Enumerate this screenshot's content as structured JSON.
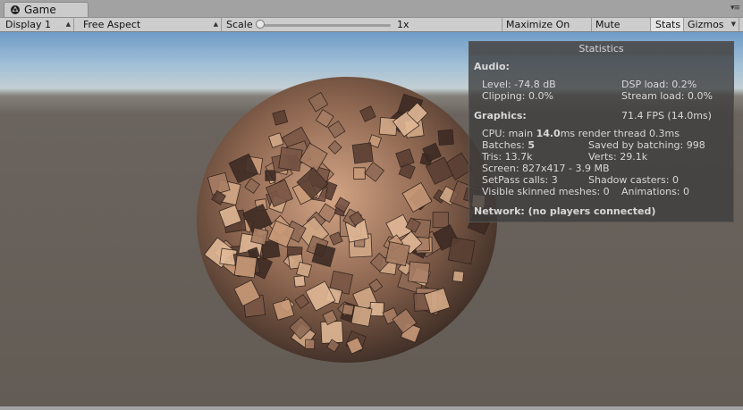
{
  "tab": {
    "title": "Game",
    "icon": "unity-logo-icon",
    "menu_glyph": "▾≡"
  },
  "toolbar": {
    "display": "Display 1",
    "aspect": "Free Aspect",
    "scale_label": "Scale",
    "scale_value": "1x",
    "scale_slider_level": 0,
    "maximize": "Maximize On Play",
    "mute": "Mute Audio",
    "stats": "Stats",
    "gizmos": "Gizmos"
  },
  "stats": {
    "title": "Statistics",
    "audio_header": "Audio:",
    "level": "Level: -74.8 dB",
    "dsp_load": "DSP load: 0.2%",
    "clipping": "Clipping: 0.0%",
    "stream_load": "Stream load: 0.0%",
    "graphics_header": "Graphics:",
    "fps": "71.4 FPS (14.0ms)",
    "cpu_prefix": "CPU: main ",
    "cpu_main": "14.0",
    "cpu_suffix": "ms  render thread 0.3ms",
    "batches_prefix": "Batches: ",
    "batches_value": "5",
    "saved_batching": "Saved by batching: 998",
    "tris": "Tris: 13.7k",
    "verts": "Verts: 29.1k",
    "screen": "Screen: 827x417 - 3.9 MB",
    "setpass": "SetPass calls: 3",
    "shadow_casters": "Shadow casters: 0",
    "skinned": "Visible skinned meshes: 0",
    "animations": "Animations: 0",
    "network": "Network: (no players connected)"
  },
  "colors": {
    "sky_top": "#6f9cc8",
    "ground": "#635c55",
    "cube_tint": "#b08060",
    "panel": "#3c3c3c"
  }
}
